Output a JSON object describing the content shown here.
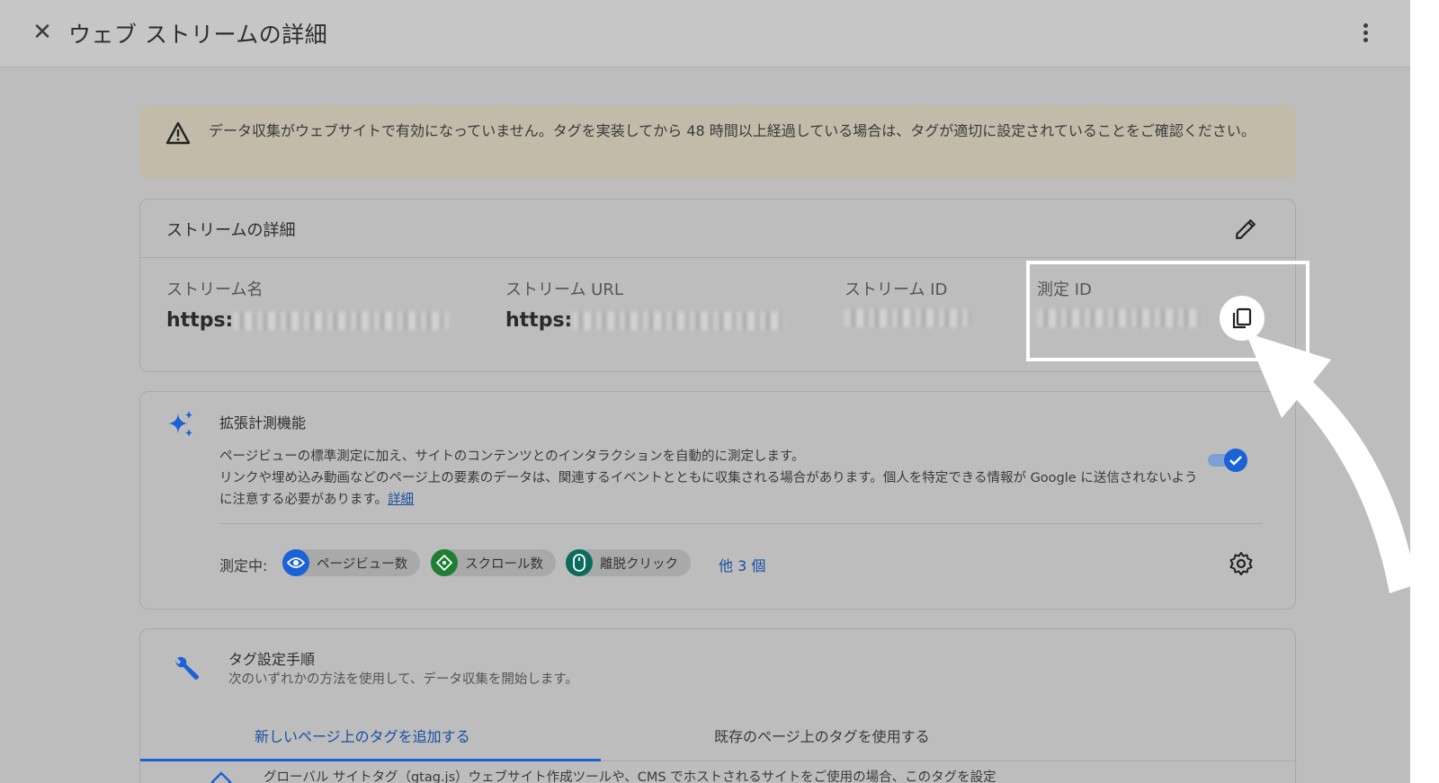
{
  "header": {
    "close_icon": "close-icon",
    "title": "ウェブ ストリームの詳細",
    "more_icon": "more-vert-icon"
  },
  "warning": {
    "icon": "warning-icon",
    "text": "データ収集がウェブサイトで有効になっていません。タグを実装してから 48 時間以上経過している場合は、タグが適切に設定されていることをご確認ください。"
  },
  "stream_details": {
    "title": "ストリームの詳細",
    "edit_icon": "pencil-icon",
    "fields": [
      {
        "label": "ストリーム名",
        "value": "https:"
      },
      {
        "label": "ストリーム URL",
        "value": "https:"
      },
      {
        "label": "ストリーム ID",
        "value": ""
      },
      {
        "label": "測定 ID",
        "value": ""
      }
    ],
    "copy_icon": "copy-icon"
  },
  "enhanced": {
    "icon": "sparkle-icon",
    "title": "拡張計測機能",
    "desc_line1": "ページビューの標準測定に加え、サイトのコンテンツとのインタラクションを自動的に測定します。",
    "desc_line2": "リンクや埋め込み動画などのページ上の要素のデータは、関連するイベントとともに収集される場合があります。個人を特定できる情報が Google に送信されないように注意する必要があります。",
    "link": "詳細",
    "toggle_on": true,
    "measuring_label": "測定中:",
    "chips": [
      {
        "label": "ページビュー数",
        "icon": "eye-icon",
        "color": "#1a62d6"
      },
      {
        "label": "スクロール数",
        "icon": "scroll-icon",
        "color": "#1e7e34"
      },
      {
        "label": "離脱クリック",
        "icon": "mouse-icon",
        "color": "#0d6b5e"
      }
    ],
    "more": "他 3 個",
    "settings_icon": "gear-icon"
  },
  "tag_setup": {
    "icon": "wrench-icon",
    "title": "タグ設定手順",
    "subtitle": "次のいずれかの方法を使用して、データ収集を開始します。",
    "tabs": [
      "新しいページ上のタグを追加する",
      "既存のページ上のタグを使用する"
    ],
    "item_text": "グローバル サイトタグ（gtag.js）ウェブサイト作成ツールや、CMS でホストされるサイトをご使用の場合、このタグを設定"
  },
  "colors": {
    "accent": "#1a62d6",
    "link": "#1a4fa3",
    "warning_bg": "#c2bba9"
  }
}
